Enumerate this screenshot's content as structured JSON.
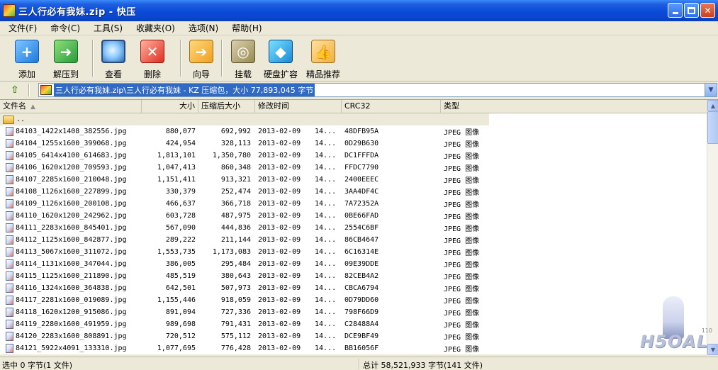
{
  "window": {
    "title": "三人行必有我妹.zip - 快压"
  },
  "menu": {
    "items": [
      {
        "label": "文件(F)"
      },
      {
        "label": "命令(C)"
      },
      {
        "label": "工具(S)"
      },
      {
        "label": "收藏夹(O)"
      },
      {
        "label": "选项(N)"
      },
      {
        "label": "帮助(H)"
      }
    ]
  },
  "toolbar": {
    "add": "添加",
    "extract": "解压到",
    "view": "查看",
    "delete": "删除",
    "wizard": "向导",
    "mount": "挂载",
    "disk": "硬盘扩容",
    "premium": "精品推荐"
  },
  "address": {
    "path": "三人行必有我妹.zip\\三人行必有我妹 - KZ 压缩包，大小 77,893,045 字节"
  },
  "columns": {
    "name": "文件名",
    "size": "大小",
    "packed": "压缩后大小",
    "modified": "修改时间",
    "crc": "CRC32",
    "type": "类型"
  },
  "parent_row": "..",
  "files": [
    {
      "name": "84103_1422x1408_382556.jpg",
      "size": "880,077",
      "packed": "692,992",
      "date": "2013-02-09",
      "time": "14...",
      "crc": "48DFB95A",
      "type": "JPEG 图像"
    },
    {
      "name": "84104_1255x1600_399068.jpg",
      "size": "424,954",
      "packed": "328,113",
      "date": "2013-02-09",
      "time": "14...",
      "crc": "0D29B630",
      "type": "JPEG 图像"
    },
    {
      "name": "84105_6414x4100_614683.jpg",
      "size": "1,813,101",
      "packed": "1,350,780",
      "date": "2013-02-09",
      "time": "14...",
      "crc": "DC1FFFDA",
      "type": "JPEG 图像"
    },
    {
      "name": "84106_1620x1200_709593.jpg",
      "size": "1,047,413",
      "packed": "860,348",
      "date": "2013-02-09",
      "time": "14...",
      "crc": "FFDC7790",
      "type": "JPEG 图像"
    },
    {
      "name": "84107_2285x1600_210048.jpg",
      "size": "1,151,411",
      "packed": "913,321",
      "date": "2013-02-09",
      "time": "14...",
      "crc": "2400EEEC",
      "type": "JPEG 图像"
    },
    {
      "name": "84108_1126x1600_227899.jpg",
      "size": "330,379",
      "packed": "252,474",
      "date": "2013-02-09",
      "time": "14...",
      "crc": "3AA4DF4C",
      "type": "JPEG 图像"
    },
    {
      "name": "84109_1126x1600_200108.jpg",
      "size": "466,637",
      "packed": "366,718",
      "date": "2013-02-09",
      "time": "14...",
      "crc": "7A72352A",
      "type": "JPEG 图像"
    },
    {
      "name": "84110_1620x1200_242962.jpg",
      "size": "603,728",
      "packed": "487,975",
      "date": "2013-02-09",
      "time": "14...",
      "crc": "0BE66FAD",
      "type": "JPEG 图像"
    },
    {
      "name": "84111_2283x1600_845401.jpg",
      "size": "567,090",
      "packed": "444,836",
      "date": "2013-02-09",
      "time": "14...",
      "crc": "2554C6BF",
      "type": "JPEG 图像"
    },
    {
      "name": "84112_1125x1600_842877.jpg",
      "size": "289,222",
      "packed": "211,144",
      "date": "2013-02-09",
      "time": "14...",
      "crc": "86CB4647",
      "type": "JPEG 图像"
    },
    {
      "name": "84113_5067x1600_311072.jpg",
      "size": "1,553,735",
      "packed": "1,173,083",
      "date": "2013-02-09",
      "time": "14...",
      "crc": "6C16314E",
      "type": "JPEG 图像"
    },
    {
      "name": "84114_1131x1600_347044.jpg",
      "size": "386,005",
      "packed": "295,484",
      "date": "2013-02-09",
      "time": "14...",
      "crc": "09E39DDE",
      "type": "JPEG 图像"
    },
    {
      "name": "84115_1125x1600_211890.jpg",
      "size": "485,519",
      "packed": "380,643",
      "date": "2013-02-09",
      "time": "14...",
      "crc": "82CEB4A2",
      "type": "JPEG 图像"
    },
    {
      "name": "84116_1324x1600_364838.jpg",
      "size": "642,501",
      "packed": "507,973",
      "date": "2013-02-09",
      "time": "14...",
      "crc": "CBCA6794",
      "type": "JPEG 图像"
    },
    {
      "name": "84117_2281x1600_019089.jpg",
      "size": "1,155,446",
      "packed": "918,059",
      "date": "2013-02-09",
      "time": "14...",
      "crc": "0D79DD60",
      "type": "JPEG 图像"
    },
    {
      "name": "84118_1620x1200_915086.jpg",
      "size": "891,094",
      "packed": "727,336",
      "date": "2013-02-09",
      "time": "14...",
      "crc": "798F66D9",
      "type": "JPEG 图像"
    },
    {
      "name": "84119_2280x1600_491959.jpg",
      "size": "989,698",
      "packed": "791,431",
      "date": "2013-02-09",
      "time": "14...",
      "crc": "C28488A4",
      "type": "JPEG 图像"
    },
    {
      "name": "84120_2283x1600_808891.jpg",
      "size": "720,512",
      "packed": "575,112",
      "date": "2013-02-09",
      "time": "14...",
      "crc": "DCE9BF49",
      "type": "JPEG 图像"
    },
    {
      "name": "84121_5922x4091_133310.jpg",
      "size": "1,077,695",
      "packed": "776,428",
      "date": "2013-02-09",
      "time": "14...",
      "crc": "BB16056F",
      "type": "JPEG 图像"
    }
  ],
  "status": {
    "left": "选中  0 字节(1 文件)",
    "right": "总计  58,521,933 字节(141 文件)"
  },
  "watermark": {
    "brand": "H5OAL",
    "version": "110"
  },
  "icons": {
    "app": "kuaiya-app-icon",
    "add": "add-icon",
    "extract": "extract-icon",
    "view": "magnifier-icon",
    "delete": "delete-icon",
    "wizard": "wizard-arrow-icon",
    "mount": "mount-disc-icon",
    "disk": "disk-expand-icon",
    "premium": "thumbs-up-icon"
  }
}
